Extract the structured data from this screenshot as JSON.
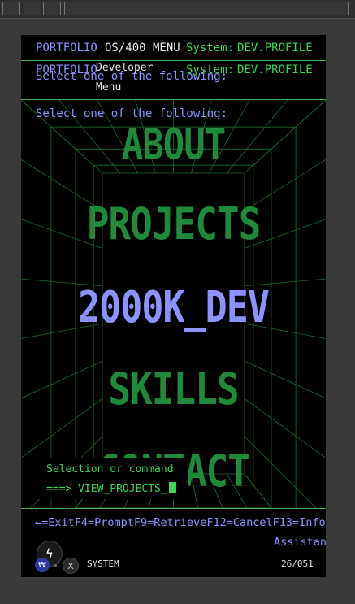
{
  "header": {
    "app": "PORTFOLIO",
    "menu_title": "OS/400 MENU",
    "system_label": "System:",
    "system_value": "DEV.PROFILE"
  },
  "header_overlap": {
    "app": "PORTFOLIO",
    "menu_title_line1": "Developer",
    "menu_title_line2": "Menu",
    "system_label": "System:",
    "system_value": "DEV.PROFILE",
    "ghost_prompt": "Select one of the following:"
  },
  "prompt": "Select one of the following:",
  "menu": {
    "items": [
      {
        "label": "ABOUT",
        "selected": false
      },
      {
        "label": "PROJECTS",
        "selected": false
      },
      {
        "label": "2000K_DEV",
        "selected": true
      },
      {
        "label": "SKILLS",
        "selected": false
      },
      {
        "label": "CONTACT",
        "selected": false
      }
    ]
  },
  "command": {
    "label": "Selection or command",
    "arrow": "===>",
    "value": "VIEW_PROJECTS_"
  },
  "function_keys": {
    "line1": "←=ExitF4=PromptF9=RetrieveF12=CancelF13=Info",
    "line2": "Assistan"
  },
  "status": {
    "left": "SYSTEM",
    "right": "26/051"
  },
  "buttons": {
    "bolt": "ϟ",
    "w": "₩",
    "x": "X"
  },
  "colors": {
    "green": "#35d65a",
    "menu_green": "#1f8a3a",
    "blue": "#8c93ff",
    "grid_line": "#1f6a2a"
  }
}
